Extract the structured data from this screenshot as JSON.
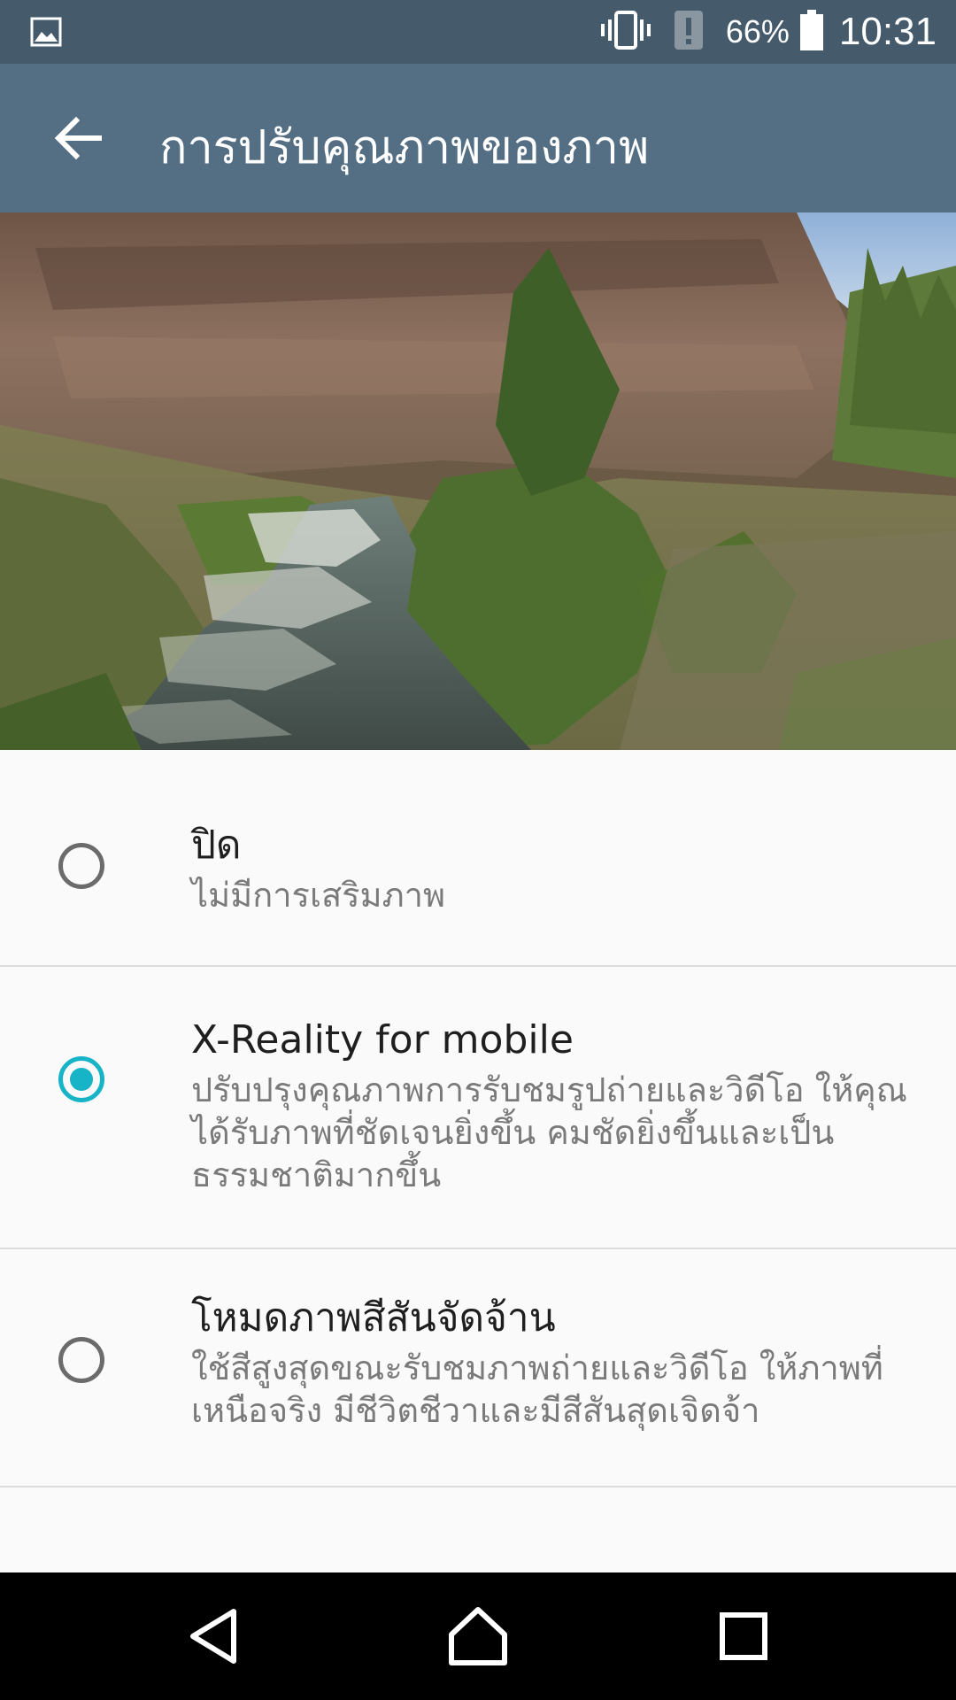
{
  "status_bar": {
    "battery_percent": "66%",
    "time": "10:31",
    "icons": [
      "image-notification-icon",
      "vibrate-icon",
      "alert-icon",
      "battery-icon"
    ]
  },
  "app_bar": {
    "title": "การปรับคุณภาพของภาพ",
    "back_icon": "arrow-left-icon"
  },
  "preview_image": {
    "subject": "river canyon landscape"
  },
  "options": [
    {
      "title": "ปิด",
      "description": "ไม่มีการเสริมภาพ",
      "selected": false
    },
    {
      "title": "X-Reality for mobile",
      "description": "ปรับปรุงคุณภาพการรับชมรูปถ่ายและวิดีโอ ให้คุณได้รับภาพที่ชัดเจนยิ่งขึ้น คมชัดยิ่งขึ้นและเป็นธรรมชาติมากขึ้น",
      "selected": true
    },
    {
      "title": "โหมดภาพสีสันจัดจ้าน",
      "description": "ใช้สีสูงสุดขณะรับชมภาพถ่ายและวิดีโอ ให้ภาพที่เหนือจริง มีชีวิตชีวาและมีสีสันสุดเจิดจ้า",
      "selected": false
    }
  ],
  "colors": {
    "status_bar": "#455a6b",
    "app_bar": "#546e84",
    "accent": "#17b3c6",
    "background": "#fafafa"
  },
  "nav_bar": {
    "buttons": [
      "back-icon",
      "home-icon",
      "recents-icon"
    ]
  }
}
